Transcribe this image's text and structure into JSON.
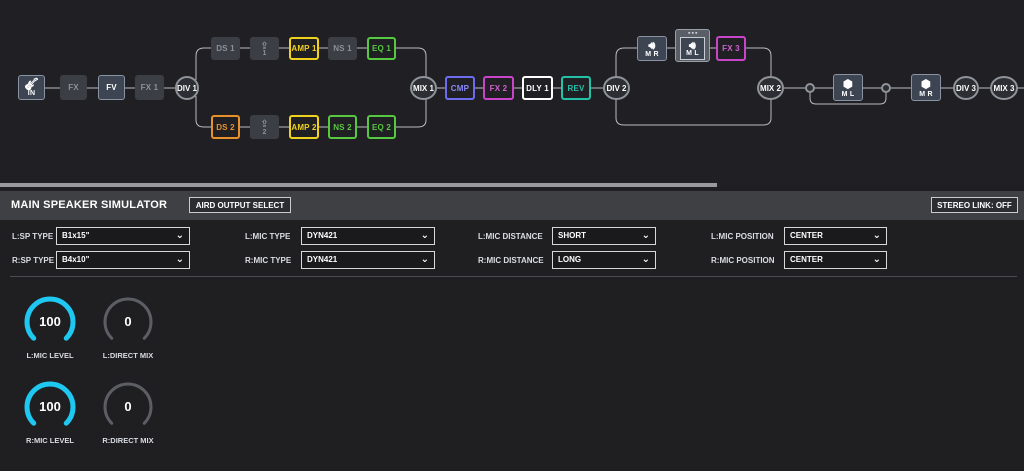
{
  "chain": {
    "in": {
      "label": "IN",
      "icon": "guitar-icon"
    },
    "fx": "FX",
    "fv": "FV",
    "fx1": "FX 1",
    "div1": "DIV 1",
    "top": {
      "ds": "DS 1",
      "send": "1",
      "amp": "AMP 1",
      "ns": "NS 1",
      "eq": "EQ 1"
    },
    "bottom": {
      "ds": "DS 2",
      "send": "2",
      "amp": "AMP 2",
      "ns": "NS 2",
      "eq": "EQ 2"
    },
    "mix1": "MIX 1",
    "cmp": "CMP",
    "fx2": "FX 2",
    "dly1": "DLY 1",
    "rev": "REV",
    "div2": "DIV 2",
    "mr1": "M R",
    "ml1": "M L",
    "fx3": "FX 3",
    "mix2": "MIX 2",
    "ml2": "M L",
    "mr2": "M R",
    "div3": "DIV 3",
    "mix3": "MIX 3",
    "colors": {
      "orange": "#e8912b",
      "yellow": "#f0d21e",
      "green": "#56c940",
      "blue": "#6d6bf0",
      "magenta": "#c844c8",
      "teal": "#23c1a8",
      "white": "#ffffff"
    }
  },
  "panel": {
    "title": "MAIN SPEAKER SIMULATOR",
    "aird_button": "AIRD OUTPUT SELECT",
    "stereo_button": "STEREO LINK: OFF"
  },
  "params": {
    "l_sp_type": {
      "label": "L:SP TYPE",
      "value": "B1x15\""
    },
    "r_sp_type": {
      "label": "R:SP TYPE",
      "value": "B4x10\""
    },
    "l_mic_type": {
      "label": "L:MIC TYPE",
      "value": "DYN421"
    },
    "r_mic_type": {
      "label": "R:MIC TYPE",
      "value": "DYN421"
    },
    "l_mic_distance": {
      "label": "L:MIC DISTANCE",
      "value": "SHORT"
    },
    "r_mic_distance": {
      "label": "R:MIC DISTANCE",
      "value": "LONG"
    },
    "l_mic_position": {
      "label": "L:MIC POSITION",
      "value": "CENTER"
    },
    "r_mic_position": {
      "label": "R:MIC POSITION",
      "value": "CENTER"
    }
  },
  "knobs": {
    "l_mic_level": {
      "label": "L:MIC LEVEL",
      "value": "100",
      "level": 1.0
    },
    "l_direct_mix": {
      "label": "L:DIRECT MIX",
      "value": "0",
      "level": 0.0
    },
    "r_mic_level": {
      "label": "R:MIC LEVEL",
      "value": "100",
      "level": 1.0
    },
    "r_direct_mix": {
      "label": "R:DIRECT MIX",
      "value": "0",
      "level": 0.0
    }
  },
  "knob_colors": {
    "active": "#1ec8f0",
    "track": "#5c5e64"
  }
}
